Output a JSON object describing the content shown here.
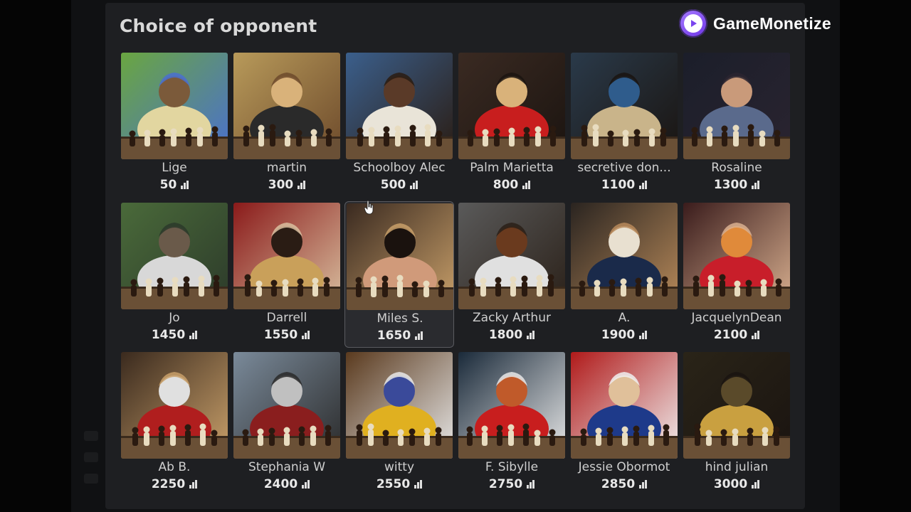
{
  "panel": {
    "title": "Choice of opponent"
  },
  "brand": {
    "name": "GameMonetize",
    "icon": "play-icon"
  },
  "rating_icon": "bar-chart-icon",
  "opponents": [
    {
      "name": "Lige",
      "rating": "50",
      "palette": [
        "#6aa640",
        "#e2d6a0",
        "#7b5a3a",
        "#4a6fd0"
      ]
    },
    {
      "name": "martin",
      "rating": "300",
      "palette": [
        "#b89a5a",
        "#2a2a2a",
        "#d9b27a",
        "#6d4a2b"
      ]
    },
    {
      "name": "Schoolboy Alec",
      "rating": "500",
      "palette": [
        "#3b5f8c",
        "#e9e4d8",
        "#5a3a28",
        "#2a1c12"
      ]
    },
    {
      "name": "Palm Marietta",
      "rating": "800",
      "palette": [
        "#3a2a22",
        "#c81e1e",
        "#d9b27a",
        "#1b1410"
      ]
    },
    {
      "name": "secretive don...",
      "rating": "1100",
      "palette": [
        "#2a3a4a",
        "#c9b48a",
        "#2f5c8c",
        "#1a1410"
      ]
    },
    {
      "name": "Rosaline",
      "rating": "1300",
      "palette": [
        "#1b1e2a",
        "#5a6a8c",
        "#c99a7a",
        "#2a2430"
      ]
    },
    {
      "name": "Jo",
      "rating": "1450",
      "palette": [
        "#4a6a3a",
        "#d8d8d8",
        "#6a5a4a",
        "#2c3a2a"
      ]
    },
    {
      "name": "Darrell",
      "rating": "1550",
      "palette": [
        "#8a1a1a",
        "#c9a05a",
        "#2a1c14",
        "#d9c0a0"
      ]
    },
    {
      "name": "Miles S.",
      "rating": "1650",
      "palette": [
        "#3a2a20",
        "#d09a7a",
        "#1a120e",
        "#c9a06a"
      ]
    },
    {
      "name": "Zacky Arthur",
      "rating": "1800",
      "palette": [
        "#5a5a5a",
        "#e0e0e0",
        "#6a3a1e",
        "#2a2018"
      ]
    },
    {
      "name": "A.",
      "rating": "1900",
      "palette": [
        "#2a2420",
        "#1a2a4a",
        "#e8e0d0",
        "#b88a5a"
      ]
    },
    {
      "name": "JacquelynDean",
      "rating": "2100",
      "palette": [
        "#3a1c1c",
        "#c81e2a",
        "#e08a3a",
        "#d9b090"
      ]
    },
    {
      "name": "Ab B.",
      "rating": "2250",
      "palette": [
        "#3a2a1e",
        "#b01e1e",
        "#e0e0e0",
        "#c9a06a"
      ]
    },
    {
      "name": "Stephania W",
      "rating": "2400",
      "palette": [
        "#7a8a9a",
        "#8a1e1e",
        "#c0c0c0",
        "#2a2a2a"
      ]
    },
    {
      "name": "witty",
      "rating": "2550",
      "palette": [
        "#5a3a1e",
        "#e0b020",
        "#3a4a9a",
        "#e8e8e8"
      ]
    },
    {
      "name": "F. Sibylle",
      "rating": "2750",
      "palette": [
        "#1a2a3a",
        "#c81e1e",
        "#c05a2a",
        "#e8e8e8"
      ]
    },
    {
      "name": "Jessie Obormot",
      "rating": "2850",
      "palette": [
        "#b01a1a",
        "#1e3a8a",
        "#e0c09a",
        "#f0f0f0"
      ]
    },
    {
      "name": "hind julian",
      "rating": "3000",
      "palette": [
        "#2a2418",
        "#c9a040",
        "#5a4a2a",
        "#1a1410"
      ]
    }
  ]
}
